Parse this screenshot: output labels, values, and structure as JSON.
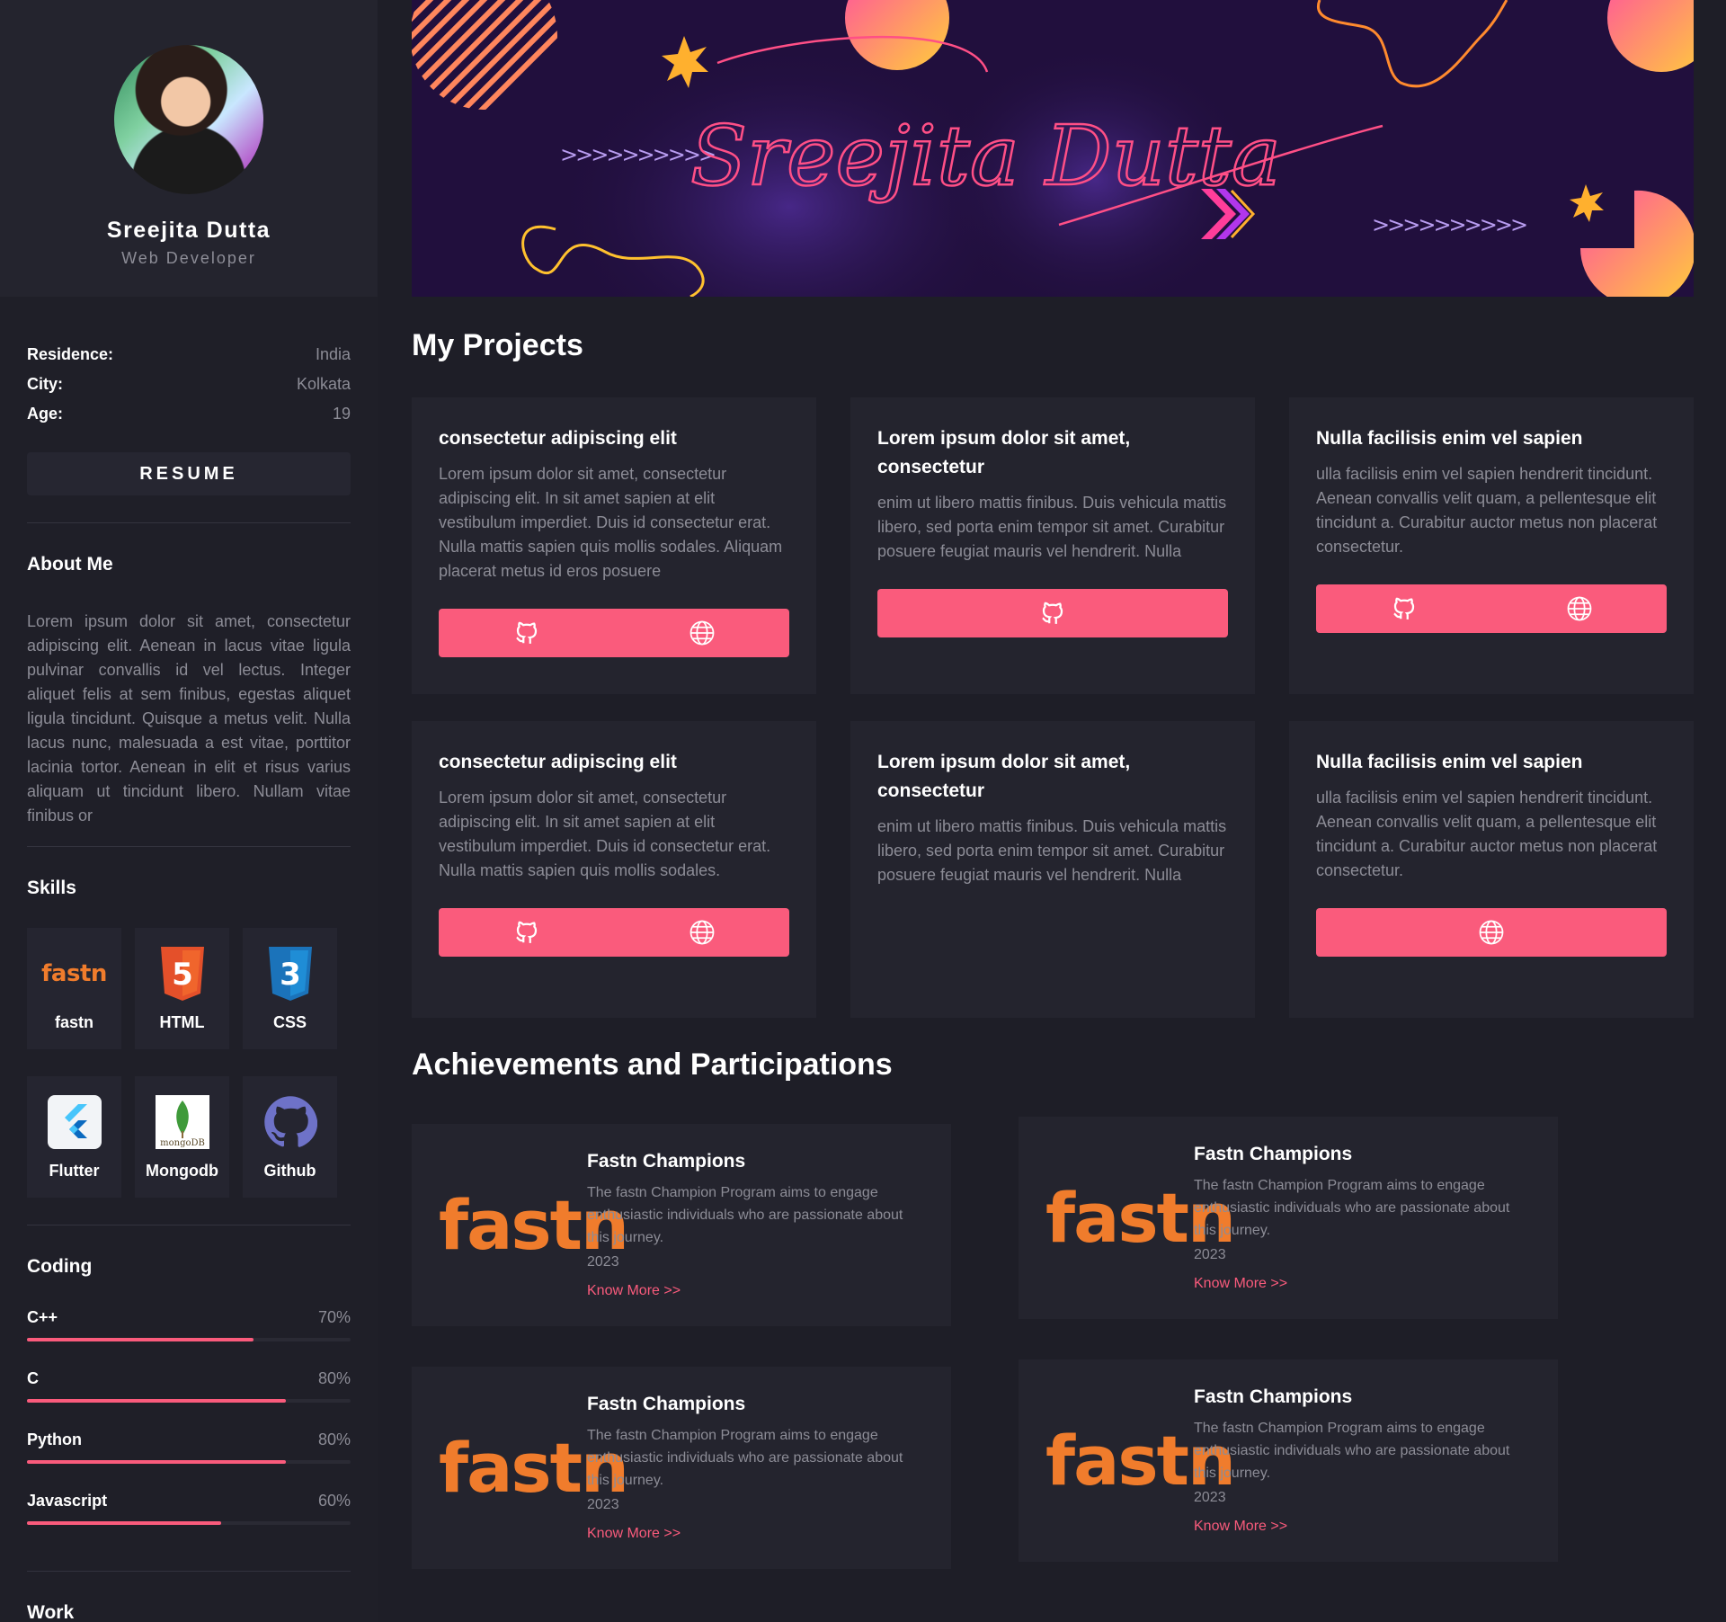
{
  "profile": {
    "name": "Sreejita Dutta",
    "role": "Web Developer"
  },
  "info": [
    {
      "label": "Residence:",
      "value": "India"
    },
    {
      "label": "City:",
      "value": "Kolkata"
    },
    {
      "label": "Age:",
      "value": "19"
    }
  ],
  "resume_label": "RESUME",
  "about": {
    "heading": "About Me",
    "text": "Lorem ipsum dolor sit amet, consectetur adipiscing elit. Aenean in lacus vitae ligula pulvinar convallis id vel lectus. Integer aliquet felis at sem finibus, egestas aliquet ligula tincidunt. Quisque a metus velit. Nulla lacus nunc, malesuada a est vitae, porttitor lacinia tortor. Aenean in elit et risus varius aliquam ut tincidunt libero. Nullam vitae finibus or"
  },
  "skills": {
    "heading": "Skills",
    "items": [
      {
        "label": "fastn",
        "icon": "fastn-logo-icon",
        "logo_text": "fastn"
      },
      {
        "label": "HTML",
        "icon": "html5-icon",
        "logo_text": "5"
      },
      {
        "label": "CSS",
        "icon": "css3-icon",
        "logo_text": "3"
      },
      {
        "label": "Flutter",
        "icon": "flutter-icon"
      },
      {
        "label": "Mongodb",
        "icon": "mongodb-icon",
        "logo_text": "mongoDB"
      },
      {
        "label": "Github",
        "icon": "github-icon"
      }
    ]
  },
  "coding": {
    "heading": "Coding",
    "items": [
      {
        "name": "C++",
        "percent_label": "70%",
        "percent": 70
      },
      {
        "name": "C",
        "percent_label": "80%",
        "percent": 80
      },
      {
        "name": "Python",
        "percent_label": "80%",
        "percent": 80
      },
      {
        "name": "Javascript",
        "percent_label": "60%",
        "percent": 60
      }
    ]
  },
  "work_heading": "Work",
  "banner": {
    "signature": "Sreejita Dutta",
    "arrows": ">>>>>>>>>>"
  },
  "projects": {
    "heading": "My Projects",
    "items": [
      {
        "title": "consectetur adipiscing elit",
        "desc": "Lorem ipsum dolor sit amet, consectetur adipiscing elit. In sit amet sapien at elit vestibulum imperdiet. Duis id consectetur erat. Nulla mattis sapien quis mollis sodales. Aliquam placerat metus id eros posuere",
        "links": [
          "github-icon",
          "globe-icon"
        ]
      },
      {
        "title": "Lorem ipsum dolor sit amet, consectetur",
        "desc": "enim ut libero mattis finibus. Duis vehicula mattis libero, sed porta enim tempor sit amet. Curabitur posuere feugiat mauris vel hendrerit. Nulla",
        "links": [
          "github-icon"
        ]
      },
      {
        "title": "Nulla facilisis enim vel sapien",
        "desc": "ulla facilisis enim vel sapien hendrerit tincidunt. Aenean convallis velit quam, a pellentesque elit tincidunt a. Curabitur auctor metus non placerat consectetur.",
        "links": [
          "github-icon",
          "globe-icon"
        ]
      },
      {
        "title": "consectetur adipiscing elit",
        "desc": "Lorem ipsum dolor sit amet, consectetur adipiscing elit. In sit amet sapien at elit vestibulum imperdiet. Duis id consectetur erat. Nulla mattis sapien quis mollis sodales.",
        "links": [
          "github-icon",
          "globe-icon"
        ]
      },
      {
        "title": "Lorem ipsum dolor sit amet, consectetur",
        "desc": "enim ut libero mattis finibus. Duis vehicula mattis libero, sed porta enim tempor sit amet. Curabitur posuere feugiat mauris vel hendrerit. Nulla",
        "links": []
      },
      {
        "title": "Nulla facilisis enim vel sapien",
        "desc": "ulla facilisis enim vel sapien hendrerit tincidunt. Aenean convallis velit quam, a pellentesque elit tincidunt a. Curabitur auctor metus non placerat consectetur.",
        "links": [
          "globe-icon"
        ]
      }
    ]
  },
  "achievements": {
    "heading": "Achievements and Participations",
    "items": [
      {
        "logo": "fastn",
        "title": "Fastn Champions",
        "desc": "The fastn Champion Program aims to engage enthusiastic individuals who are passionate about this journey.",
        "year": "2023",
        "link": "Know More >>"
      },
      {
        "logo": "fastn",
        "title": "Fastn Champions",
        "desc": "The fastn Champion Program aims to engage enthusiastic individuals who are passionate about this journey.",
        "year": "2023",
        "link": "Know More >>"
      },
      {
        "logo": "fastn",
        "title": "Fastn Champions",
        "desc": "The fastn Champion Program aims to engage enthusiastic individuals who are passionate about this journey.",
        "year": "2023",
        "link": "Know More >>"
      },
      {
        "logo": "fastn",
        "title": "Fastn Champions",
        "desc": "The fastn Champion Program aims to engage enthusiastic individuals who are passionate about this journey.",
        "year": "2023",
        "link": "Know More >>"
      }
    ]
  },
  "colors": {
    "accent": "#fa5b7c",
    "fastn_orange": "#f07c2c",
    "background": "#1e1e27",
    "card": "#24242e"
  }
}
